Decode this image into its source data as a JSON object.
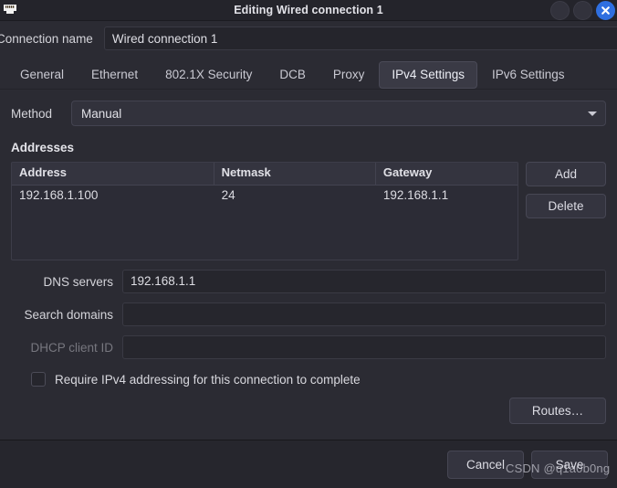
{
  "window": {
    "title": "Editing Wired connection 1",
    "icon": "ethernet-port-icon",
    "controls": {
      "minimize": "minimize",
      "maximize": "maximize",
      "close": "close"
    },
    "accent_close_color": "#2f6fe0"
  },
  "connection": {
    "name_label": "Connection name",
    "name_value": "Wired connection 1"
  },
  "tabs": [
    {
      "label": "General",
      "active": false
    },
    {
      "label": "Ethernet",
      "active": false
    },
    {
      "label": "802.1X Security",
      "active": false
    },
    {
      "label": "DCB",
      "active": false
    },
    {
      "label": "Proxy",
      "active": false
    },
    {
      "label": "IPv4 Settings",
      "active": true
    },
    {
      "label": "IPv6 Settings",
      "active": false
    }
  ],
  "method": {
    "label": "Method",
    "value": "Manual"
  },
  "addresses": {
    "section_title": "Addresses",
    "columns": [
      "Address",
      "Netmask",
      "Gateway"
    ],
    "rows": [
      {
        "address": "192.168.1.100",
        "netmask": "24",
        "gateway": "192.168.1.1"
      }
    ],
    "add_label": "Add",
    "delete_label": "Delete"
  },
  "fields": {
    "dns": {
      "label": "DNS servers",
      "value": "192.168.1.1",
      "placeholder": "",
      "disabled": false
    },
    "search_domains": {
      "label": "Search domains",
      "value": "",
      "placeholder": "",
      "disabled": false
    },
    "dhcp_client_id": {
      "label": "DHCP client ID",
      "value": "",
      "placeholder": "",
      "disabled": true
    }
  },
  "require_ipv4": {
    "label": "Require IPv4 addressing for this connection to complete",
    "checked": false
  },
  "routes": {
    "label": "Routes…"
  },
  "footer": {
    "cancel_label": "Cancel",
    "save_label": "Save"
  },
  "watermark": {
    "text": "CSDN @q1a0b0ng"
  }
}
